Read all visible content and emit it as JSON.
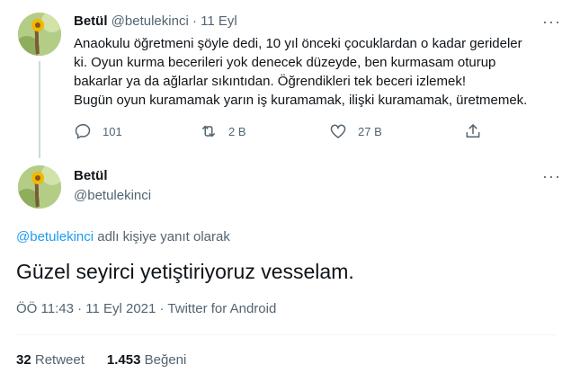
{
  "parent_tweet": {
    "name": "Betül",
    "handle": "@betulekinci",
    "separator": "·",
    "time": "11 Eyl",
    "lines": [
      "Anaokulu öğretmeni şöyle dedi, 10 yıl önceki çocuklardan o kadar gerideler",
      "ki. Oyun kurma becerileri yok denecek düzeyde, ben kurmasam oturup",
      "bakarlar ya da ağlarlar sıkıntıdan. Öğrendikleri tek beceri izlemek!",
      "Bugün oyun kuramamak yarın iş kuramamak, ilişki kuramamak, üretmemek."
    ],
    "replies": "101",
    "retweets": "2 B",
    "likes": "27 B",
    "more": "···"
  },
  "main_tweet": {
    "name": "Betül",
    "handle": "@betulekinci",
    "more": "···",
    "reply_mention": "@betulekinci",
    "reply_suffix": "adlı kişiye yanıt olarak",
    "text": "Güzel seyirci yetiştiriyoruz vesselam.",
    "timestamp": "ÖÖ 11:43 · 11 Eyl 2021 · Twitter for Android",
    "retweet_count": "32",
    "retweet_label": "Retweet",
    "like_count": "1.453",
    "like_label": "Beğeni"
  },
  "icons": {
    "reply": "reply-icon",
    "retweet": "retweet-icon",
    "like": "heart-icon",
    "share": "share-icon",
    "more": "more-icon"
  },
  "colors": {
    "accent": "#1d9bf0",
    "secondary_text": "#536471",
    "primary_text": "#0f1419"
  }
}
